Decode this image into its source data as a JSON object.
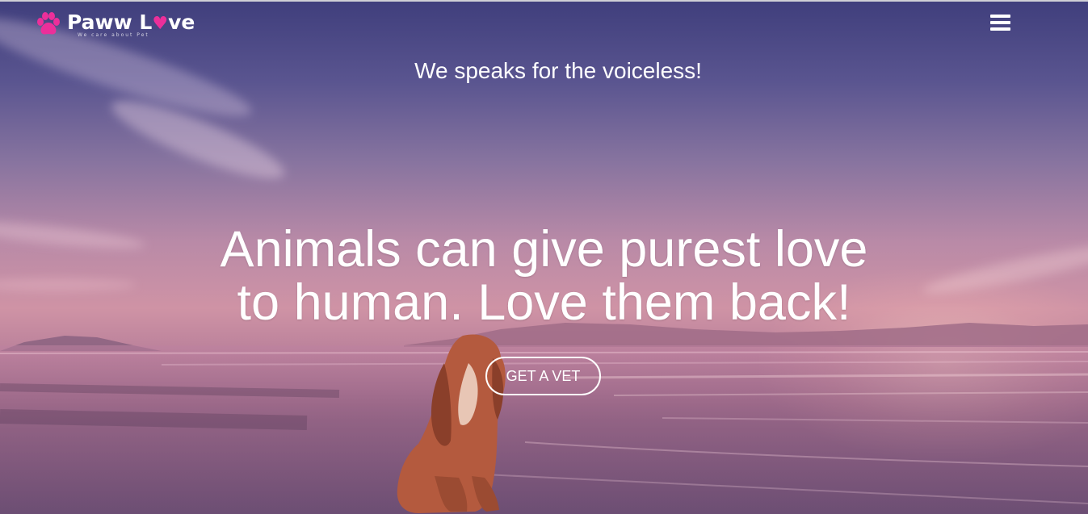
{
  "nav": {
    "brand_prefix": "Paww L",
    "brand_heart": "♥",
    "brand_suffix": "ve",
    "tagline": "We care about Pet",
    "menu_icon": "hamburger-menu-icon"
  },
  "hero": {
    "subtitle": "We speaks for the voiceless!",
    "headline_line1": "Animals can give purest love",
    "headline_line2": "to human. Love them back!",
    "cta_label": "GET A VET"
  },
  "colors": {
    "brand_accent": "#ec2f9a",
    "text": "#ffffff",
    "sky_top": "#3f3e7c",
    "horizon": "#cf93a5"
  }
}
